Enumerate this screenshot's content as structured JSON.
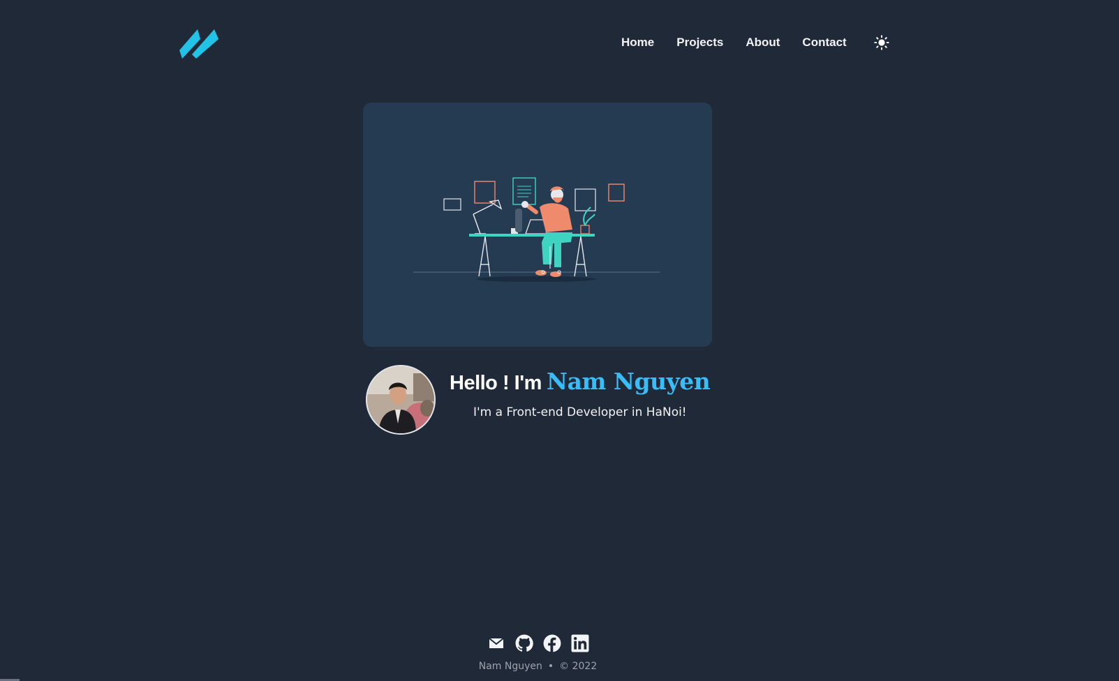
{
  "header": {
    "logo_icon": "double-slash-logo",
    "nav": [
      {
        "label": "Home"
      },
      {
        "label": "Projects"
      },
      {
        "label": "About"
      },
      {
        "label": "Contact"
      }
    ],
    "theme_toggle_icon": "sun-icon"
  },
  "hero": {
    "illustration": "developer-at-desk-illustration"
  },
  "intro": {
    "hello": "Hello ! I'm",
    "name": "Nam Nguyen",
    "tagline": "I'm a Front-end Developer in HaNoi!"
  },
  "footer": {
    "social_icons": [
      "mail-icon",
      "github-icon",
      "facebook-icon",
      "linkedin-icon"
    ],
    "author": "Nam Nguyen",
    "separator": "•",
    "copyright": "© 2022"
  },
  "colors": {
    "background": "#1f2937",
    "card": "#253b52",
    "accent": "#38bdf8",
    "logo": "#22c3e6",
    "illustration_orange": "#f08a6c",
    "illustration_teal": "#3fd4c2"
  }
}
